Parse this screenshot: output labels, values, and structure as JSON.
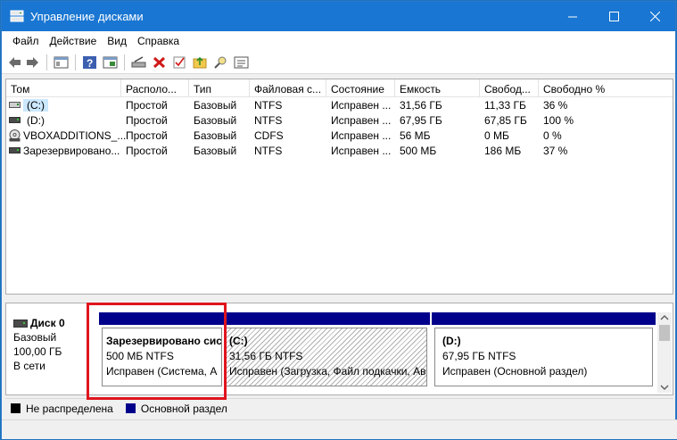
{
  "window": {
    "title": "Управление дисками"
  },
  "menu": [
    "Файл",
    "Действие",
    "Вид",
    "Справка"
  ],
  "columns": [
    "Том",
    "Располо...",
    "Тип",
    "Файловая с...",
    "Состояние",
    "Емкость",
    "Свобод...",
    "Свободно %"
  ],
  "volumes": [
    {
      "name": "(C:)",
      "layout": "Простой",
      "type": "Базовый",
      "fs": "NTFS",
      "status": "Исправен ...",
      "capacity": "31,56 ГБ",
      "free": "11,33 ГБ",
      "free_pct": "36 %",
      "icon": "drive-icon"
    },
    {
      "name": "(D:)",
      "layout": "Простой",
      "type": "Базовый",
      "fs": "NTFS",
      "status": "Исправен ...",
      "capacity": "67,95 ГБ",
      "free": "67,85 ГБ",
      "free_pct": "100 %",
      "icon": "drive-icon"
    },
    {
      "name": "VBOXADDITIONS_...",
      "layout": "Простой",
      "type": "Базовый",
      "fs": "CDFS",
      "status": "Исправен ...",
      "capacity": "56 МБ",
      "free": "0 МБ",
      "free_pct": "0 %",
      "icon": "cd-icon"
    },
    {
      "name": "Зарезервировано...",
      "layout": "Простой",
      "type": "Базовый",
      "fs": "NTFS",
      "status": "Исправен ...",
      "capacity": "500 МБ",
      "free": "186 МБ",
      "free_pct": "37 %",
      "icon": "drive-icon"
    }
  ],
  "disk": {
    "name": "Диск 0",
    "type": "Базовый",
    "size": "100,00 ГБ",
    "state": "В сети"
  },
  "partitions": [
    {
      "title": "Зарезервировано сис",
      "line2": "500 МБ NTFS",
      "line3": "Исправен (Система, А"
    },
    {
      "title": "(C:)",
      "line2": "31,56 ГБ NTFS",
      "line3": "Исправен (Загрузка, Файл подкачки, Ав"
    },
    {
      "title": "(D:)",
      "line2": "67,95 ГБ NTFS",
      "line3": "Исправен (Основной раздел)"
    }
  ],
  "legend": {
    "unallocated": "Не распределена",
    "primary": "Основной раздел"
  },
  "colors": {
    "titlebar": "#1976d2",
    "primary_partition": "#00008b",
    "unallocated": "#000000",
    "highlight": "#e0141e",
    "selection": "#cce8ff"
  }
}
